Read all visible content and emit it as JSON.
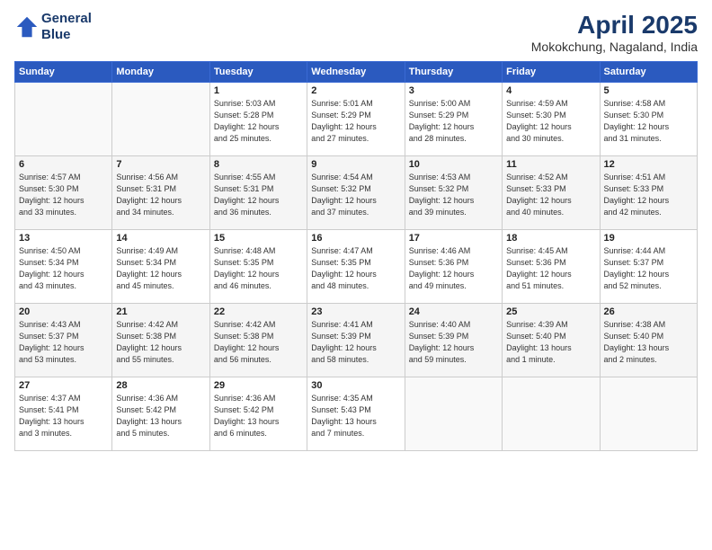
{
  "header": {
    "logo_line1": "General",
    "logo_line2": "Blue",
    "month": "April 2025",
    "location": "Mokokchung, Nagaland, India"
  },
  "days_of_week": [
    "Sunday",
    "Monday",
    "Tuesday",
    "Wednesday",
    "Thursday",
    "Friday",
    "Saturday"
  ],
  "weeks": [
    [
      {
        "day": "",
        "info": ""
      },
      {
        "day": "",
        "info": ""
      },
      {
        "day": "1",
        "info": "Sunrise: 5:03 AM\nSunset: 5:28 PM\nDaylight: 12 hours\nand 25 minutes."
      },
      {
        "day": "2",
        "info": "Sunrise: 5:01 AM\nSunset: 5:29 PM\nDaylight: 12 hours\nand 27 minutes."
      },
      {
        "day": "3",
        "info": "Sunrise: 5:00 AM\nSunset: 5:29 PM\nDaylight: 12 hours\nand 28 minutes."
      },
      {
        "day": "4",
        "info": "Sunrise: 4:59 AM\nSunset: 5:30 PM\nDaylight: 12 hours\nand 30 minutes."
      },
      {
        "day": "5",
        "info": "Sunrise: 4:58 AM\nSunset: 5:30 PM\nDaylight: 12 hours\nand 31 minutes."
      }
    ],
    [
      {
        "day": "6",
        "info": "Sunrise: 4:57 AM\nSunset: 5:30 PM\nDaylight: 12 hours\nand 33 minutes."
      },
      {
        "day": "7",
        "info": "Sunrise: 4:56 AM\nSunset: 5:31 PM\nDaylight: 12 hours\nand 34 minutes."
      },
      {
        "day": "8",
        "info": "Sunrise: 4:55 AM\nSunset: 5:31 PM\nDaylight: 12 hours\nand 36 minutes."
      },
      {
        "day": "9",
        "info": "Sunrise: 4:54 AM\nSunset: 5:32 PM\nDaylight: 12 hours\nand 37 minutes."
      },
      {
        "day": "10",
        "info": "Sunrise: 4:53 AM\nSunset: 5:32 PM\nDaylight: 12 hours\nand 39 minutes."
      },
      {
        "day": "11",
        "info": "Sunrise: 4:52 AM\nSunset: 5:33 PM\nDaylight: 12 hours\nand 40 minutes."
      },
      {
        "day": "12",
        "info": "Sunrise: 4:51 AM\nSunset: 5:33 PM\nDaylight: 12 hours\nand 42 minutes."
      }
    ],
    [
      {
        "day": "13",
        "info": "Sunrise: 4:50 AM\nSunset: 5:34 PM\nDaylight: 12 hours\nand 43 minutes."
      },
      {
        "day": "14",
        "info": "Sunrise: 4:49 AM\nSunset: 5:34 PM\nDaylight: 12 hours\nand 45 minutes."
      },
      {
        "day": "15",
        "info": "Sunrise: 4:48 AM\nSunset: 5:35 PM\nDaylight: 12 hours\nand 46 minutes."
      },
      {
        "day": "16",
        "info": "Sunrise: 4:47 AM\nSunset: 5:35 PM\nDaylight: 12 hours\nand 48 minutes."
      },
      {
        "day": "17",
        "info": "Sunrise: 4:46 AM\nSunset: 5:36 PM\nDaylight: 12 hours\nand 49 minutes."
      },
      {
        "day": "18",
        "info": "Sunrise: 4:45 AM\nSunset: 5:36 PM\nDaylight: 12 hours\nand 51 minutes."
      },
      {
        "day": "19",
        "info": "Sunrise: 4:44 AM\nSunset: 5:37 PM\nDaylight: 12 hours\nand 52 minutes."
      }
    ],
    [
      {
        "day": "20",
        "info": "Sunrise: 4:43 AM\nSunset: 5:37 PM\nDaylight: 12 hours\nand 53 minutes."
      },
      {
        "day": "21",
        "info": "Sunrise: 4:42 AM\nSunset: 5:38 PM\nDaylight: 12 hours\nand 55 minutes."
      },
      {
        "day": "22",
        "info": "Sunrise: 4:42 AM\nSunset: 5:38 PM\nDaylight: 12 hours\nand 56 minutes."
      },
      {
        "day": "23",
        "info": "Sunrise: 4:41 AM\nSunset: 5:39 PM\nDaylight: 12 hours\nand 58 minutes."
      },
      {
        "day": "24",
        "info": "Sunrise: 4:40 AM\nSunset: 5:39 PM\nDaylight: 12 hours\nand 59 minutes."
      },
      {
        "day": "25",
        "info": "Sunrise: 4:39 AM\nSunset: 5:40 PM\nDaylight: 13 hours\nand 1 minute."
      },
      {
        "day": "26",
        "info": "Sunrise: 4:38 AM\nSunset: 5:40 PM\nDaylight: 13 hours\nand 2 minutes."
      }
    ],
    [
      {
        "day": "27",
        "info": "Sunrise: 4:37 AM\nSunset: 5:41 PM\nDaylight: 13 hours\nand 3 minutes."
      },
      {
        "day": "28",
        "info": "Sunrise: 4:36 AM\nSunset: 5:42 PM\nDaylight: 13 hours\nand 5 minutes."
      },
      {
        "day": "29",
        "info": "Sunrise: 4:36 AM\nSunset: 5:42 PM\nDaylight: 13 hours\nand 6 minutes."
      },
      {
        "day": "30",
        "info": "Sunrise: 4:35 AM\nSunset: 5:43 PM\nDaylight: 13 hours\nand 7 minutes."
      },
      {
        "day": "",
        "info": ""
      },
      {
        "day": "",
        "info": ""
      },
      {
        "day": "",
        "info": ""
      }
    ]
  ]
}
